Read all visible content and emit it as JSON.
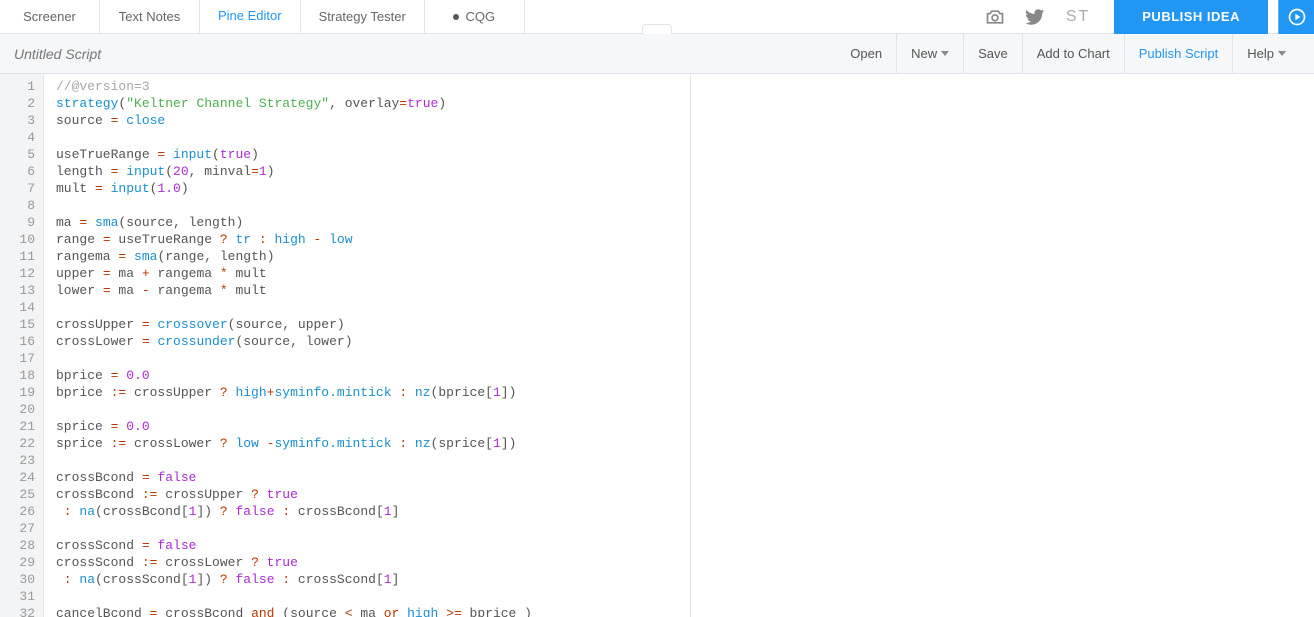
{
  "tabs": {
    "screener": "Screener",
    "textnotes": "Text Notes",
    "pineeditor": "Pine Editor",
    "strategytester": "Strategy Tester",
    "cqg": "CQG"
  },
  "topActions": {
    "st": "ST",
    "publishIdea": "PUBLISH IDEA"
  },
  "subBar": {
    "title": "Untitled Script",
    "open": "Open",
    "new": "New",
    "save": "Save",
    "addToChart": "Add to Chart",
    "publishScript": "Publish Script",
    "help": "Help"
  },
  "code": {
    "lines": [
      [
        [
          "//@version=3",
          "comment"
        ]
      ],
      [
        [
          "strategy",
          "builtin"
        ],
        [
          "(",
          "punc"
        ],
        [
          "\"Keltner Channel Strategy\"",
          "string"
        ],
        [
          ", ",
          "punc"
        ],
        [
          "overlay",
          "ident"
        ],
        [
          "=",
          "op"
        ],
        [
          "true",
          "bool"
        ],
        [
          ")",
          "punc"
        ]
      ],
      [
        [
          "source ",
          "ident"
        ],
        [
          "= ",
          "op"
        ],
        [
          "close",
          "builtin"
        ]
      ],
      [],
      [
        [
          "useTrueRange ",
          "ident"
        ],
        [
          "= ",
          "op"
        ],
        [
          "input",
          "builtin"
        ],
        [
          "(",
          "punc"
        ],
        [
          "true",
          "bool"
        ],
        [
          ")",
          "punc"
        ]
      ],
      [
        [
          "length ",
          "ident"
        ],
        [
          "= ",
          "op"
        ],
        [
          "input",
          "builtin"
        ],
        [
          "(",
          "punc"
        ],
        [
          "20",
          "number"
        ],
        [
          ", ",
          "punc"
        ],
        [
          "minval",
          "ident"
        ],
        [
          "=",
          "op"
        ],
        [
          "1",
          "number"
        ],
        [
          ")",
          "punc"
        ]
      ],
      [
        [
          "mult ",
          "ident"
        ],
        [
          "= ",
          "op"
        ],
        [
          "input",
          "builtin"
        ],
        [
          "(",
          "punc"
        ],
        [
          "1.0",
          "number"
        ],
        [
          ")",
          "punc"
        ]
      ],
      [],
      [
        [
          "ma ",
          "ident"
        ],
        [
          "= ",
          "op"
        ],
        [
          "sma",
          "builtin"
        ],
        [
          "(",
          "punc"
        ],
        [
          "source",
          "ident"
        ],
        [
          ", ",
          "punc"
        ],
        [
          "length",
          "ident"
        ],
        [
          ")",
          "punc"
        ]
      ],
      [
        [
          "range ",
          "ident"
        ],
        [
          "= ",
          "op"
        ],
        [
          "useTrueRange ",
          "ident"
        ],
        [
          "? ",
          "op"
        ],
        [
          "tr ",
          "builtin"
        ],
        [
          ": ",
          "op"
        ],
        [
          "high ",
          "builtin"
        ],
        [
          "- ",
          "op"
        ],
        [
          "low",
          "builtin"
        ]
      ],
      [
        [
          "rangema ",
          "ident"
        ],
        [
          "= ",
          "op"
        ],
        [
          "sma",
          "builtin"
        ],
        [
          "(",
          "punc"
        ],
        [
          "range",
          "ident"
        ],
        [
          ", ",
          "punc"
        ],
        [
          "length",
          "ident"
        ],
        [
          ")",
          "punc"
        ]
      ],
      [
        [
          "upper ",
          "ident"
        ],
        [
          "= ",
          "op"
        ],
        [
          "ma ",
          "ident"
        ],
        [
          "+ ",
          "op"
        ],
        [
          "rangema ",
          "ident"
        ],
        [
          "* ",
          "op"
        ],
        [
          "mult",
          "ident"
        ]
      ],
      [
        [
          "lower ",
          "ident"
        ],
        [
          "= ",
          "op"
        ],
        [
          "ma ",
          "ident"
        ],
        [
          "- ",
          "op"
        ],
        [
          "rangema ",
          "ident"
        ],
        [
          "* ",
          "op"
        ],
        [
          "mult",
          "ident"
        ]
      ],
      [],
      [
        [
          "crossUpper ",
          "ident"
        ],
        [
          "= ",
          "op"
        ],
        [
          "crossover",
          "builtin"
        ],
        [
          "(",
          "punc"
        ],
        [
          "source",
          "ident"
        ],
        [
          ", ",
          "punc"
        ],
        [
          "upper",
          "ident"
        ],
        [
          ")",
          "punc"
        ]
      ],
      [
        [
          "crossLower ",
          "ident"
        ],
        [
          "= ",
          "op"
        ],
        [
          "crossunder",
          "builtin"
        ],
        [
          "(",
          "punc"
        ],
        [
          "source",
          "ident"
        ],
        [
          ", ",
          "punc"
        ],
        [
          "lower",
          "ident"
        ],
        [
          ")",
          "punc"
        ]
      ],
      [],
      [
        [
          "bprice ",
          "ident"
        ],
        [
          "= ",
          "op"
        ],
        [
          "0.0",
          "number"
        ]
      ],
      [
        [
          "bprice ",
          "ident"
        ],
        [
          ":= ",
          "op"
        ],
        [
          "crossUpper ",
          "ident"
        ],
        [
          "? ",
          "op"
        ],
        [
          "high",
          "builtin"
        ],
        [
          "+",
          "op"
        ],
        [
          "syminfo.mintick",
          "builtin"
        ],
        [
          " : ",
          "op"
        ],
        [
          "nz",
          "builtin"
        ],
        [
          "(",
          "punc"
        ],
        [
          "bprice",
          "ident"
        ],
        [
          "[",
          "punc"
        ],
        [
          "1",
          "number"
        ],
        [
          "]",
          "punc"
        ],
        [
          ")",
          "punc"
        ]
      ],
      [],
      [
        [
          "sprice ",
          "ident"
        ],
        [
          "= ",
          "op"
        ],
        [
          "0.0",
          "number"
        ]
      ],
      [
        [
          "sprice ",
          "ident"
        ],
        [
          ":= ",
          "op"
        ],
        [
          "crossLower ",
          "ident"
        ],
        [
          "? ",
          "op"
        ],
        [
          "low ",
          "builtin"
        ],
        [
          "-",
          "op"
        ],
        [
          "syminfo.mintick",
          "builtin"
        ],
        [
          " : ",
          "op"
        ],
        [
          "nz",
          "builtin"
        ],
        [
          "(",
          "punc"
        ],
        [
          "sprice",
          "ident"
        ],
        [
          "[",
          "punc"
        ],
        [
          "1",
          "number"
        ],
        [
          "]",
          "punc"
        ],
        [
          ")",
          "punc"
        ]
      ],
      [],
      [
        [
          "crossBcond ",
          "ident"
        ],
        [
          "= ",
          "op"
        ],
        [
          "false",
          "bool"
        ]
      ],
      [
        [
          "crossBcond ",
          "ident"
        ],
        [
          ":= ",
          "op"
        ],
        [
          "crossUpper ",
          "ident"
        ],
        [
          "? ",
          "op"
        ],
        [
          "true",
          "bool"
        ]
      ],
      [
        [
          " : ",
          "op"
        ],
        [
          "na",
          "builtin"
        ],
        [
          "(",
          "punc"
        ],
        [
          "crossBcond",
          "ident"
        ],
        [
          "[",
          "punc"
        ],
        [
          "1",
          "number"
        ],
        [
          "]",
          "punc"
        ],
        [
          ") ",
          "punc"
        ],
        [
          "? ",
          "op"
        ],
        [
          "false",
          "bool"
        ],
        [
          " : ",
          "op"
        ],
        [
          "crossBcond",
          "ident"
        ],
        [
          "[",
          "punc"
        ],
        [
          "1",
          "number"
        ],
        [
          "]",
          "punc"
        ]
      ],
      [],
      [
        [
          "crossScond ",
          "ident"
        ],
        [
          "= ",
          "op"
        ],
        [
          "false",
          "bool"
        ]
      ],
      [
        [
          "crossScond ",
          "ident"
        ],
        [
          ":= ",
          "op"
        ],
        [
          "crossLower ",
          "ident"
        ],
        [
          "? ",
          "op"
        ],
        [
          "true",
          "bool"
        ]
      ],
      [
        [
          " : ",
          "op"
        ],
        [
          "na",
          "builtin"
        ],
        [
          "(",
          "punc"
        ],
        [
          "crossScond",
          "ident"
        ],
        [
          "[",
          "punc"
        ],
        [
          "1",
          "number"
        ],
        [
          "]",
          "punc"
        ],
        [
          ") ",
          "punc"
        ],
        [
          "? ",
          "op"
        ],
        [
          "false",
          "bool"
        ],
        [
          " : ",
          "op"
        ],
        [
          "crossScond",
          "ident"
        ],
        [
          "[",
          "punc"
        ],
        [
          "1",
          "number"
        ],
        [
          "]",
          "punc"
        ]
      ],
      [],
      [
        [
          "cancelBcond ",
          "ident"
        ],
        [
          "= ",
          "op"
        ],
        [
          "crossBcond ",
          "ident"
        ],
        [
          "and ",
          "keyword"
        ],
        [
          "(",
          "punc"
        ],
        [
          "source ",
          "ident"
        ],
        [
          "< ",
          "op"
        ],
        [
          "ma ",
          "ident"
        ],
        [
          "or ",
          "keyword"
        ],
        [
          "high ",
          "builtin"
        ],
        [
          ">= ",
          "op"
        ],
        [
          "bprice ",
          "ident"
        ],
        [
          ")",
          "punc"
        ]
      ]
    ]
  }
}
